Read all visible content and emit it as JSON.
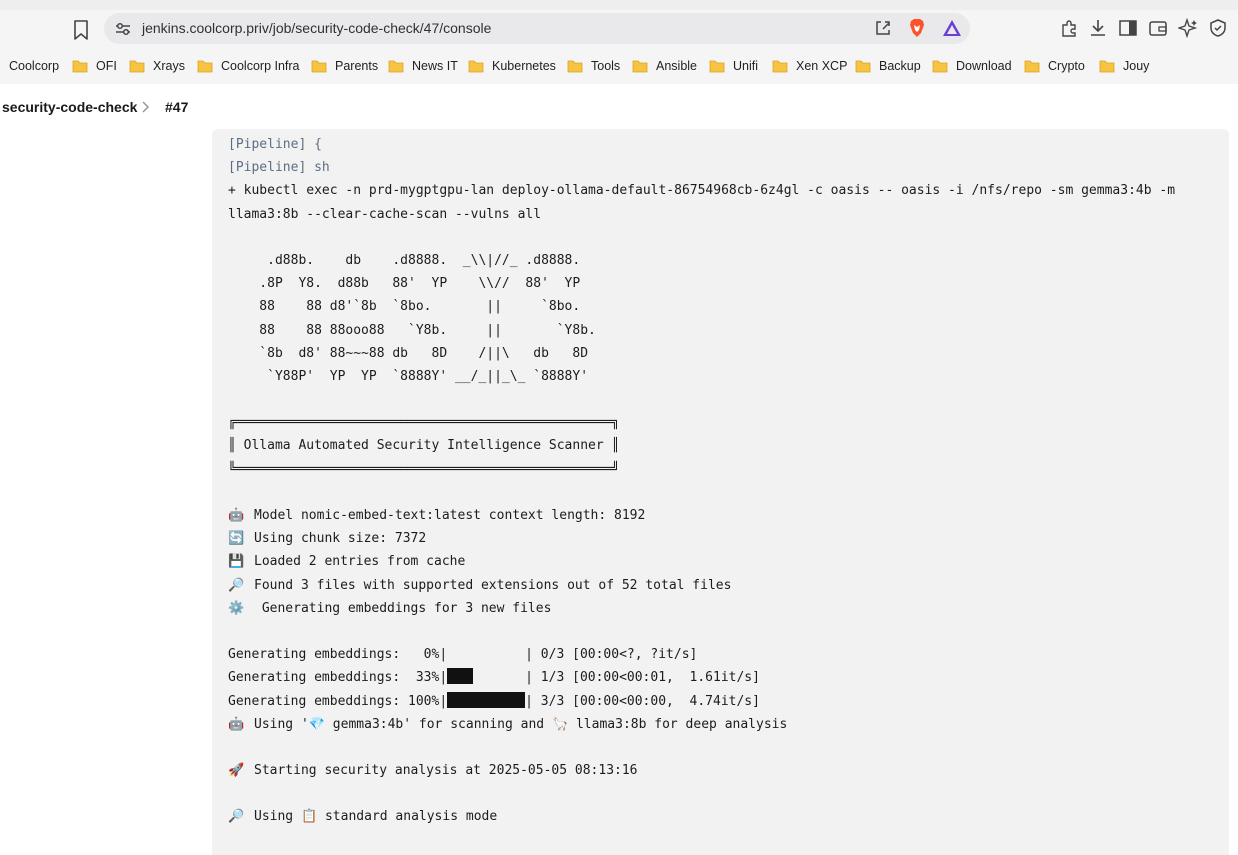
{
  "browser": {
    "url": "jenkins.coolcorp.priv/job/security-code-check/47/console"
  },
  "bookmarks": [
    {
      "label": "Coolcorp"
    },
    {
      "label": "OFI"
    },
    {
      "label": "Xrays"
    },
    {
      "label": "Coolcorp Infra"
    },
    {
      "label": "Parents"
    },
    {
      "label": "News IT"
    },
    {
      "label": "Kubernetes"
    },
    {
      "label": "Tools"
    },
    {
      "label": "Ansible"
    },
    {
      "label": "Unifi"
    },
    {
      "label": "Xen XCP"
    },
    {
      "label": "Backup"
    },
    {
      "label": "Download"
    },
    {
      "label": "Crypto"
    },
    {
      "label": "Jouy"
    }
  ],
  "breadcrumb": {
    "job": "security-code-check",
    "build": "#47"
  },
  "console": {
    "pipeline_open": "[Pipeline] {",
    "pipeline_sh": "[Pipeline] sh",
    "cmd_line1": "+ kubectl exec -n prd-mygptgpu-lan deploy-ollama-default-86754968cb-6z4gl -c oasis -- oasis -i /nfs/repo -sm gemma3:4b -m",
    "cmd_line2": "llama3:8b --clear-cache-scan --vulns all",
    "ascii": [
      "     .d88b.    db    .d8888.  _\\\\|//_ .d8888.",
      "    .8P  Y8.  d88b   88'  YP    \\\\//  88'  YP",
      "    88    88 d8'`8b  `8bo.       ||     `8bo.",
      "    88    88 88ooo88   `Y8b.     ||       `Y8b.",
      "    `8b  d8' 88~~~88 db   8D    /||\\   db   8D",
      "     `Y88P'  YP  YP  `8888Y' __/_||_\\_ `8888Y'"
    ],
    "box_top": "╔════════════════════════════════════════════════╗",
    "box_mid": "║ Ollama Automated Security Intelligence Scanner ║",
    "box_bot": "╚════════════════════════════════════════════════╝",
    "info": [
      {
        "icon": "robot-emoji",
        "glyph": "🤖",
        "text": "Model nomic-embed-text:latest context length: 8192"
      },
      {
        "icon": "cycle-emoji",
        "glyph": "🔄",
        "text": "Using chunk size: 7372"
      },
      {
        "icon": "floppy-disk-emoji",
        "glyph": "💾",
        "text": "Loaded 2 entries from cache"
      },
      {
        "icon": "magnifier-emoji",
        "glyph": "🔎",
        "text": "Found 3 files with supported extensions out of 52 total files"
      },
      {
        "icon": "gear-emoji",
        "glyph": "⚙️",
        "text": " Generating embeddings for 3 new files"
      }
    ],
    "progress": [
      {
        "prefix": "Generating embeddings:   0%|",
        "fraction": 0,
        "suffix": "| 0/3 [00:00<?, ?it/s]"
      },
      {
        "prefix": "Generating embeddings:  33%|",
        "fraction": 0.33,
        "suffix": "| 1/3 [00:00<00:01,  1.61it/s]"
      },
      {
        "prefix": "Generating embeddings: 100%|",
        "fraction": 1,
        "suffix": "| 3/3 [00:00<00:00,  4.74it/s]"
      }
    ],
    "models_line": {
      "robot": "🤖",
      "part1": "Using '",
      "gem": "💎",
      "part2": " gemma3:4b' for scanning and ",
      "llama": "🦙",
      "part3": " llama3:8b for deep analysis"
    },
    "start_line": {
      "glyph": "🚀",
      "text": "Starting security analysis at 2025-05-05 08:13:16"
    },
    "mode_line": {
      "glyph": "🔎",
      "part1": "Using ",
      "clipboard": "📋",
      "part2": " standard analysis mode"
    }
  }
}
